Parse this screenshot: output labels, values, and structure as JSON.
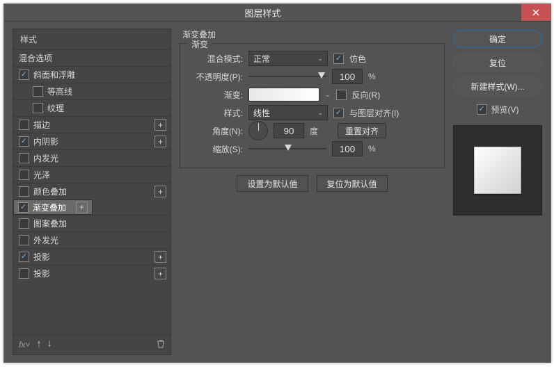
{
  "window": {
    "title": "图层样式"
  },
  "sidebar_headers": {
    "styles": "样式",
    "blending": "混合选项"
  },
  "styles": [
    {
      "label": "斜面和浮雕",
      "checked": true,
      "indent": false,
      "addable": false,
      "selected": false
    },
    {
      "label": "等高线",
      "checked": false,
      "indent": true,
      "addable": false,
      "selected": false
    },
    {
      "label": "纹理",
      "checked": false,
      "indent": true,
      "addable": false,
      "selected": false
    },
    {
      "label": "描边",
      "checked": false,
      "indent": false,
      "addable": true,
      "selected": false
    },
    {
      "label": "内阴影",
      "checked": true,
      "indent": false,
      "addable": true,
      "selected": false
    },
    {
      "label": "内发光",
      "checked": false,
      "indent": false,
      "addable": false,
      "selected": false
    },
    {
      "label": "光泽",
      "checked": false,
      "indent": false,
      "addable": false,
      "selected": false
    },
    {
      "label": "颜色叠加",
      "checked": false,
      "indent": false,
      "addable": true,
      "selected": false
    },
    {
      "label": "渐变叠加",
      "checked": true,
      "indent": false,
      "addable": true,
      "selected": true
    },
    {
      "label": "图案叠加",
      "checked": false,
      "indent": false,
      "addable": false,
      "selected": false
    },
    {
      "label": "外发光",
      "checked": false,
      "indent": false,
      "addable": false,
      "selected": false
    },
    {
      "label": "投影",
      "checked": true,
      "indent": false,
      "addable": true,
      "selected": false
    },
    {
      "label": "投影",
      "checked": false,
      "indent": false,
      "addable": true,
      "selected": false
    }
  ],
  "buttons": {
    "ok": "确定",
    "cancel": "复位",
    "new_style": "新建样式(W)...",
    "preview": "预览(V)",
    "make_default": "设置为默认值",
    "reset_default": "复位为默认值",
    "reset_align": "重置对齐"
  },
  "panel": {
    "section_title": "渐变叠加",
    "fieldset_legend": "渐变",
    "labels": {
      "blend_mode": "混合模式:",
      "opacity": "不透明度(P):",
      "gradient": "渐变:",
      "style": "样式:",
      "angle": "角度(N):",
      "scale": "缩放(S):",
      "degree_unit": "度",
      "percent_unit": "%"
    },
    "values": {
      "blend_mode": "正常",
      "opacity": "100",
      "style": "线性",
      "angle": "90",
      "scale": "100"
    },
    "checks": {
      "dither": {
        "label": "仿色",
        "checked": true
      },
      "reverse": {
        "label": "反向(R)",
        "checked": false
      },
      "align": {
        "label": "与图层对齐(I)",
        "checked": true
      }
    }
  },
  "preview_checked": true
}
